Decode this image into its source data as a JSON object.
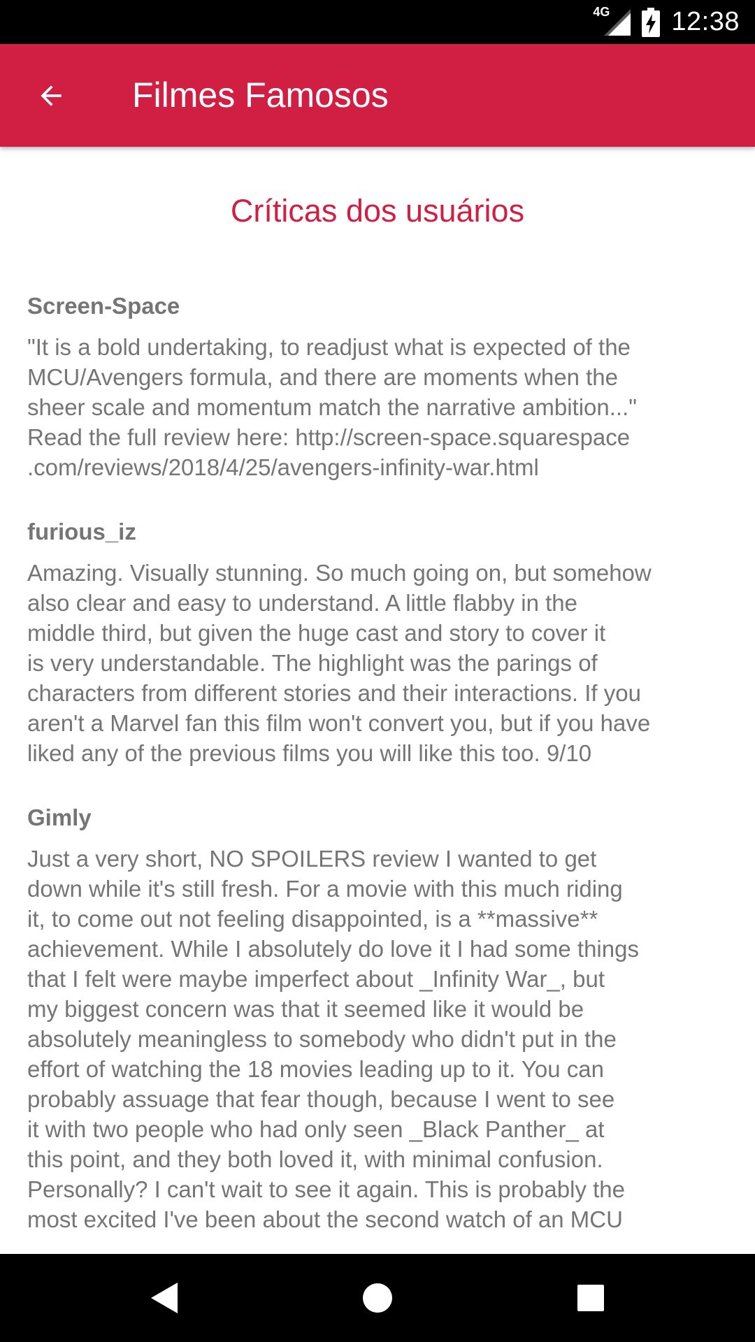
{
  "status_bar": {
    "network_label": "4G",
    "time": "12:38"
  },
  "app_bar": {
    "title": "Filmes Famosos",
    "background_color": "#d11f43"
  },
  "section": {
    "title": "Críticas dos usuários",
    "title_color": "#d11f43"
  },
  "reviews": [
    {
      "author": "Screen-Space",
      "content": "\"It is a bold undertaking, to readjust what is expected of the\nMCU/Avengers formula, and there are moments when the\nsheer scale and momentum match the narrative ambition...\"\nRead the full review here: http://screen-space.squarespace\n.com/reviews/2018/4/25/avengers-infinity-war.html"
    },
    {
      "author": "furious_iz",
      "content": "Amazing. Visually stunning. So much going on, but somehow\nalso clear and easy to understand. A little flabby in the\nmiddle third, but given the huge cast and story to cover it\nis very understandable. The highlight was the parings of\ncharacters from different stories and their interactions. If you\naren't a Marvel fan this film won't convert you, but if you have\nliked any of the previous films you will like this too. 9/10"
    },
    {
      "author": "Gimly",
      "content": "Just a very short, NO SPOILERS review I wanted to get\ndown while it's still fresh. For a movie with this much riding\nit, to come out not feeling disappointed, is a **massive**\nachievement. While I absolutely do love it I had some things\nthat I felt were maybe imperfect about _Infinity War_, but\nmy biggest concern was that it seemed like it would be\nabsolutely meaningless to somebody who didn't put in the\neffort of watching the 18 movies leading up to it. You can\nprobably assuage that fear though, because I went to see\nit with two people who had only seen _Black Panther_ at\nthis point, and they both loved it, with minimal confusion.\nPersonally? I can't wait to see it again. This is probably the\nmost excited I've been about the second watch of an MCU"
    }
  ],
  "nav_bar": {
    "icons": [
      "back-triangle-icon",
      "home-circle-icon",
      "recents-square-icon"
    ]
  }
}
